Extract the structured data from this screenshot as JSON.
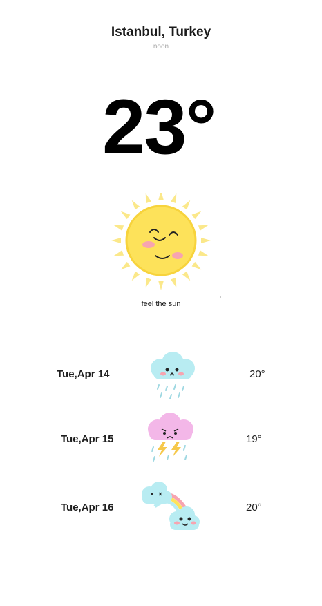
{
  "location": {
    "city": "Istanbul, Turkey",
    "time_of_day": "noon"
  },
  "current": {
    "temperature": "23°",
    "condition_icon": "happy-sun-icon",
    "caption": "feel the sun"
  },
  "forecast": [
    {
      "date": "Tue,Apr 14",
      "temperature": "20°",
      "icon": "rain-cloud-icon",
      "color": "#b8ecf2"
    },
    {
      "date": "Tue,Apr 15",
      "temperature": "19°",
      "icon": "thunderstorm-cloud-icon",
      "color": "#f3b7e8"
    },
    {
      "date": "Tue,Apr 16",
      "temperature": "20°",
      "icon": "rainbow-clouds-icon",
      "color": "#b8ecf2"
    }
  ],
  "colors": {
    "sun": "#fde25a",
    "sun_rays": "#fbe88a",
    "blush": "#f7a4b0",
    "rain": "#9fd8e2",
    "lightning": "#f6c84a"
  }
}
